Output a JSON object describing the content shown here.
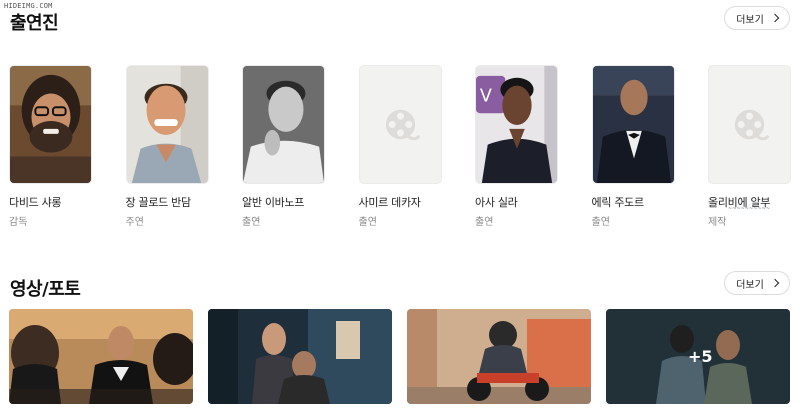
{
  "watermark": "HIDEIMG.COM",
  "cast_section": {
    "title": "출연진",
    "more_label": "더보기",
    "members": [
      {
        "name": "다비드 샤롱",
        "role": "감독",
        "photo": "photo"
      },
      {
        "name": "장 끌로드 반담",
        "role": "주연",
        "photo": "photo"
      },
      {
        "name": "알반 이바노프",
        "role": "출연",
        "photo": "photo"
      },
      {
        "name": "사미르 데카자",
        "role": "출연",
        "photo": "placeholder"
      },
      {
        "name": "아사 실라",
        "role": "출연",
        "photo": "photo"
      },
      {
        "name": "에릭 주도르",
        "role": "출연",
        "photo": "photo"
      },
      {
        "name": "올리비에 알부",
        "role": "제작",
        "photo": "placeholder"
      }
    ],
    "scribble_text": "~~~~~~~~~~"
  },
  "media_section": {
    "title": "영상/포토",
    "more_label": "더보기",
    "more_count": "+5"
  },
  "colors": {
    "placeholder_bg": "#f2f2f0",
    "placeholder_icon": "#dedcd8"
  }
}
